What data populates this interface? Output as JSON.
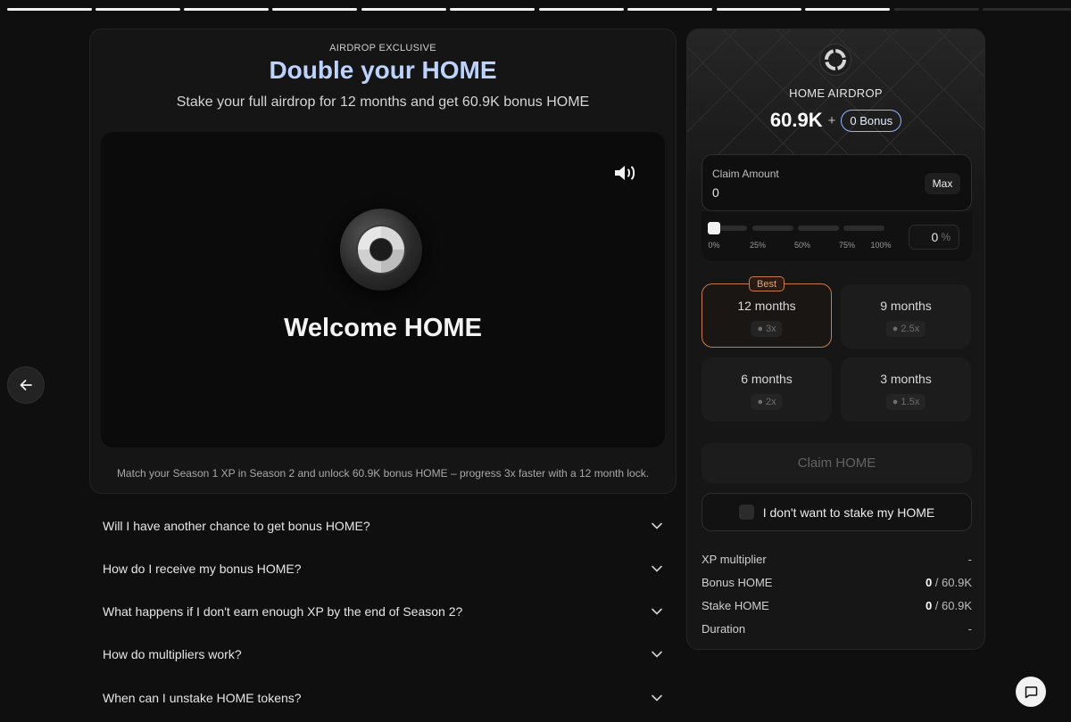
{
  "progress": {
    "total_segments": 12,
    "completed_segments": 10
  },
  "hero": {
    "eyebrow": "AIRDROP EXCLUSIVE",
    "title": "Double your HOME",
    "subtitle": "Stake your full airdrop for 12 months and get 60.9K bonus HOME"
  },
  "video": {
    "welcome_text": "Welcome HOME",
    "sound_icon": "speaker-icon"
  },
  "caption": "Match your Season 1 XP in Season 2 and unlock 60.9K bonus HOME – progress 3x faster with a 12 month lock.",
  "faq": [
    {
      "question": "Will I have another chance to get bonus HOME?"
    },
    {
      "question": "How do I receive my bonus HOME?"
    },
    {
      "question": "What happens if I don't earn enough XP by the end of Season 2?"
    },
    {
      "question": "How do multipliers work?"
    },
    {
      "question": "When can I unstake HOME tokens?"
    }
  ],
  "airdrop": {
    "label": "HOME AIRDROP",
    "amount": "60.9K",
    "plus": "+",
    "bonus": "0 Bonus"
  },
  "claim": {
    "label": "Claim Amount",
    "value": "0",
    "max_label": "Max",
    "percent_value": "0",
    "percent_sign": "%",
    "slider_fraction": 0,
    "ticks": [
      "0%",
      "25%",
      "50%",
      "75%",
      "100%"
    ]
  },
  "durations": [
    {
      "label": "12 months",
      "multiplier": "3x",
      "badge": "Best",
      "selected": true
    },
    {
      "label": "9 months",
      "multiplier": "2.5x",
      "selected": false
    },
    {
      "label": "6 months",
      "multiplier": "2x",
      "selected": false
    },
    {
      "label": "3 months",
      "multiplier": "1.5x",
      "selected": false
    }
  ],
  "claim_button": "Claim HOME",
  "no_stake": {
    "label": "I don't want to stake my HOME",
    "checked": false
  },
  "stats": [
    {
      "key": "XP multiplier",
      "value": "-"
    },
    {
      "key": "Bonus HOME",
      "value_strong": "0",
      "value_rest": " / 60.9K"
    },
    {
      "key": "Stake HOME",
      "value_strong": "0",
      "value_rest": " / 60.9K"
    },
    {
      "key": "Duration",
      "value": "-"
    }
  ],
  "colors": {
    "accent": "#bcd3ff",
    "selected_border": "#c97b47",
    "bonus_border": "#8fb3ff"
  }
}
